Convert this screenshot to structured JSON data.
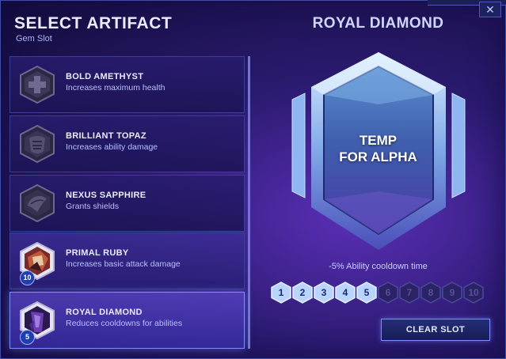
{
  "header": {
    "title": "SELECT ARTIFACT",
    "subtitle": "Gem Slot",
    "close_icon": "✕"
  },
  "artifacts": [
    {
      "name": "BOLD AMETHYST",
      "description": "Increases maximum health",
      "level": null,
      "icon": "amethyst-gem-icon",
      "state": "locked"
    },
    {
      "name": "BRILLIANT TOPAZ",
      "description": "Increases ability damage",
      "level": null,
      "icon": "topaz-gem-icon",
      "state": "locked"
    },
    {
      "name": "NEXUS SAPPHIRE",
      "description": "Grants shields",
      "level": null,
      "icon": "sapphire-gem-icon",
      "state": "locked"
    },
    {
      "name": "PRIMAL RUBY",
      "description": "Increases basic attack damage",
      "level": "10",
      "icon": "ruby-gem-icon",
      "state": "owned"
    },
    {
      "name": "ROYAL DIAMOND",
      "description": "Reduces cooldowns for abilities",
      "level": "5",
      "icon": "diamond-gem-icon",
      "state": "selected"
    }
  ],
  "detail": {
    "title": "ROYAL DIAMOND",
    "placeholder_line1": "TEMP",
    "placeholder_line2": "FOR ALPHA",
    "effect": "-5% Ability cooldown time",
    "levels": [
      "1",
      "2",
      "3",
      "4",
      "5",
      "6",
      "7",
      "8",
      "9",
      "10"
    ],
    "current_level": 5,
    "clear_label": "CLEAR SLOT"
  },
  "colors": {
    "background": "#2a1a6e",
    "accent": "#7b8dff",
    "gem_edge": "#9ec8ff"
  }
}
